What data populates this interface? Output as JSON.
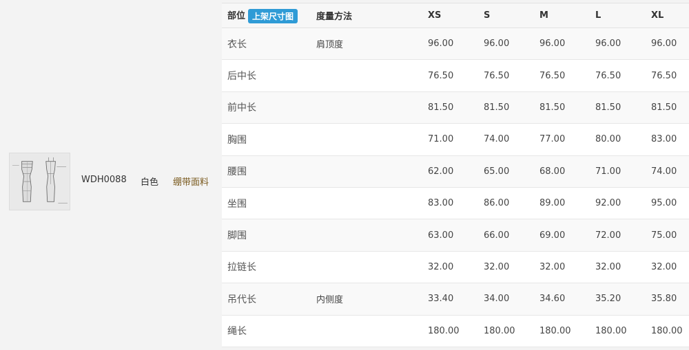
{
  "product": {
    "sku": "WDH0088",
    "color": "白色",
    "fabric": "绷带面料",
    "thumbnail_icon": "dress-sketch-image"
  },
  "table": {
    "header": {
      "part": "部位",
      "badge": "上架尺寸图",
      "method": "度量方法",
      "sizes": [
        "XS",
        "S",
        "M",
        "L",
        "XL"
      ]
    },
    "rows": [
      {
        "part": "衣长",
        "method": "肩顶度",
        "values": [
          "96.00",
          "96.00",
          "96.00",
          "96.00",
          "96.00"
        ]
      },
      {
        "part": "后中长",
        "method": "",
        "values": [
          "76.50",
          "76.50",
          "76.50",
          "76.50",
          "76.50"
        ]
      },
      {
        "part": "前中长",
        "method": "",
        "values": [
          "81.50",
          "81.50",
          "81.50",
          "81.50",
          "81.50"
        ]
      },
      {
        "part": "胸围",
        "method": "",
        "values": [
          "71.00",
          "74.00",
          "77.00",
          "80.00",
          "83.00"
        ]
      },
      {
        "part": "腰围",
        "method": "",
        "values": [
          "62.00",
          "65.00",
          "68.00",
          "71.00",
          "74.00"
        ]
      },
      {
        "part": "坐围",
        "method": "",
        "values": [
          "83.00",
          "86.00",
          "89.00",
          "92.00",
          "95.00"
        ]
      },
      {
        "part": "脚围",
        "method": "",
        "values": [
          "63.00",
          "66.00",
          "69.00",
          "72.00",
          "75.00"
        ]
      },
      {
        "part": "拉链长",
        "method": "",
        "values": [
          "32.00",
          "32.00",
          "32.00",
          "32.00",
          "32.00"
        ]
      },
      {
        "part": "吊代长",
        "method": "内侧度",
        "values": [
          "33.40",
          "34.00",
          "34.60",
          "35.20",
          "35.80"
        ]
      },
      {
        "part": "绳长",
        "method": "",
        "values": [
          "180.00",
          "180.00",
          "180.00",
          "180.00",
          "180.00"
        ]
      }
    ]
  },
  "colors": {
    "badge": "#2f9bd6",
    "fabric_text": "#7a5a1e"
  }
}
